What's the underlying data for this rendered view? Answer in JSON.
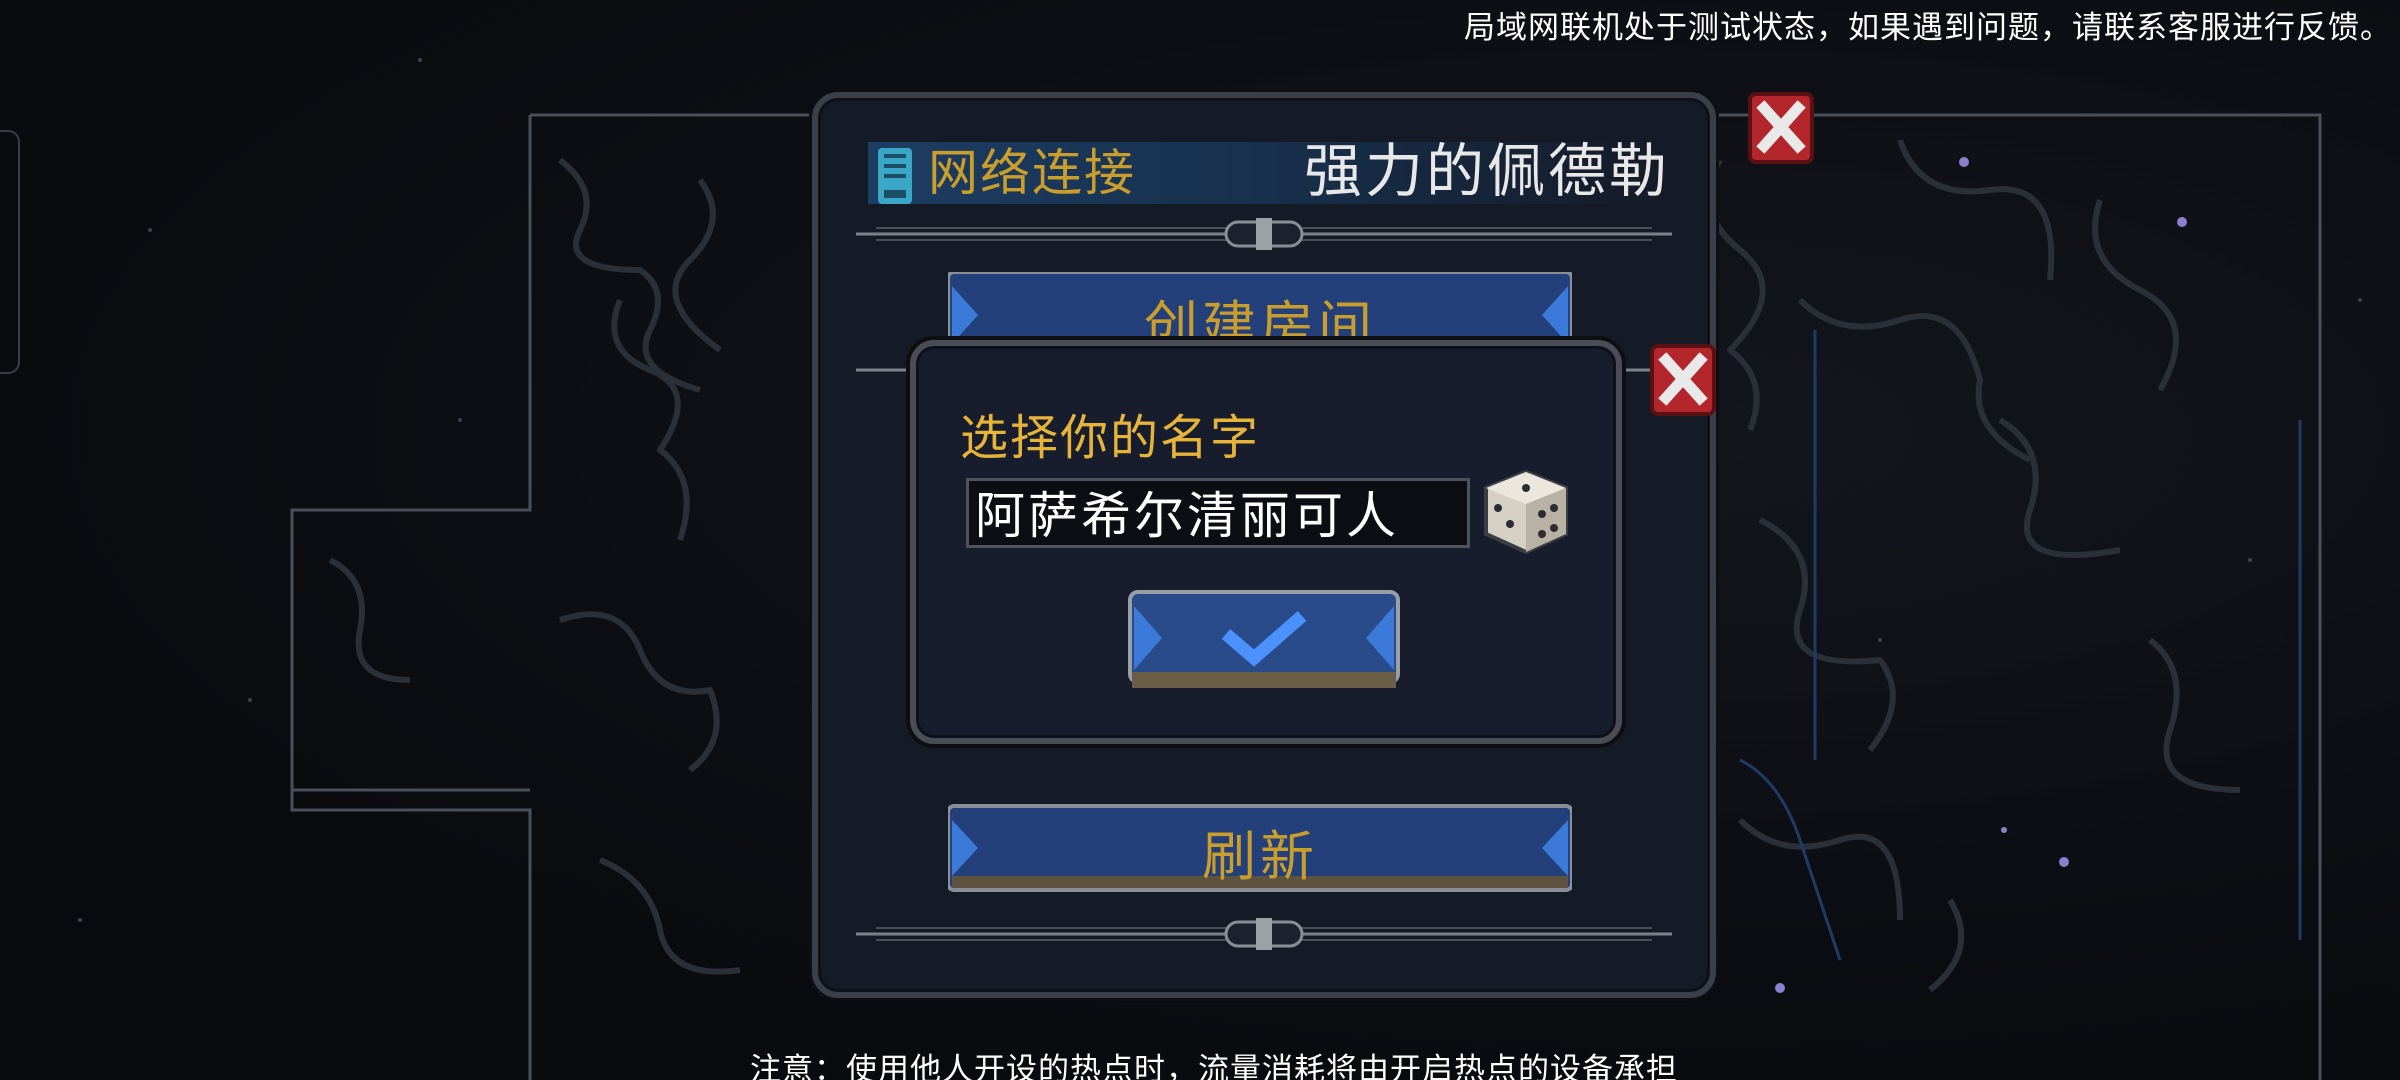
{
  "notices": {
    "top": "局域网联机处于测试状态，如果遇到问题，请联系客服进行反馈。",
    "bottom": "注意：使用他人开设的热点时，流量消耗将由开启热点的设备承担"
  },
  "network_panel": {
    "title": "网络连接",
    "player_name": "强力的佩德勒",
    "create_room_label": "创建房间",
    "refresh_label": "刷新",
    "icons": {
      "header": "network-card-icon",
      "close": "close-x-icon"
    }
  },
  "name_dialog": {
    "title": "选择你的名字",
    "name_value": "阿萨希尔清丽可人",
    "icons": {
      "random": "dice-icon",
      "confirm": "checkmark-icon",
      "close": "close-x-icon"
    }
  },
  "colors": {
    "accent_gold": "#c99e2d",
    "dialog_title": "#e7b43a",
    "button_blue": "#23407a",
    "close_red": "#b3262b",
    "frame": "#3b3f4a"
  }
}
